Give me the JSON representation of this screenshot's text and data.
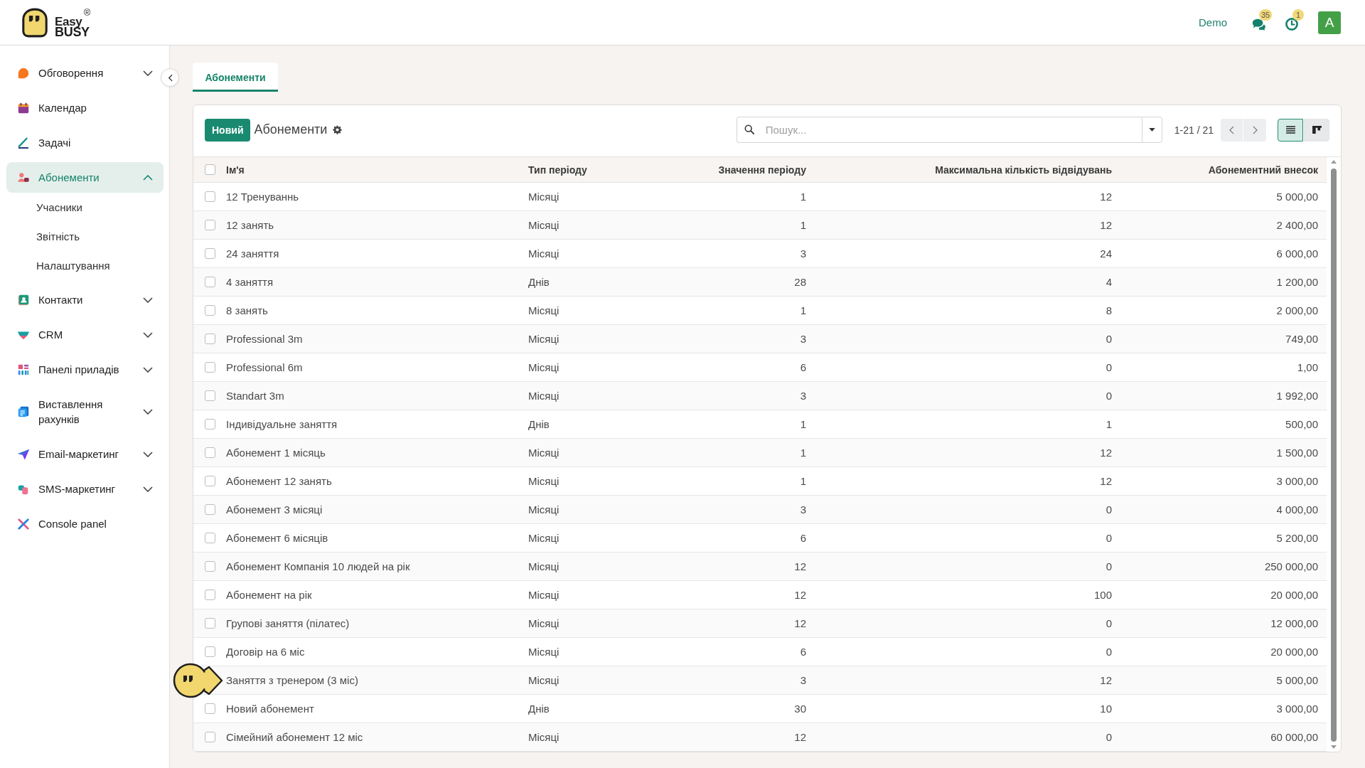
{
  "header": {
    "logo": {
      "word_top": "Easy",
      "word_bottom": "BUSY",
      "registered": "®"
    },
    "company": "Demo",
    "notifications": [
      {
        "kind": "messages",
        "count": "35"
      },
      {
        "kind": "activities",
        "count": "1"
      }
    ],
    "avatar_letter": "A"
  },
  "sidebar": {
    "items": [
      {
        "kind": "group",
        "label": "Обговорення",
        "selected": false,
        "expanded": false
      },
      {
        "kind": "link",
        "label": "Календар",
        "selected": false
      },
      {
        "kind": "link",
        "label": "Задачі",
        "selected": false
      },
      {
        "kind": "group",
        "label": "Абонементи",
        "selected": true,
        "expanded": true,
        "children": [
          {
            "label": "Учасники",
            "selected": false
          },
          {
            "label": "Звітність",
            "selected": false
          },
          {
            "label": "Налаштування",
            "selected": false
          }
        ]
      },
      {
        "kind": "group",
        "label": "Контакти",
        "selected": false,
        "expanded": false
      },
      {
        "kind": "group",
        "label": "CRM",
        "selected": false,
        "expanded": false
      },
      {
        "kind": "group",
        "label": "Панелі приладів",
        "selected": false,
        "expanded": false
      },
      {
        "kind": "group",
        "label": "Виставлення рахунків",
        "selected": false,
        "expanded": false
      },
      {
        "kind": "group",
        "label": "Email-маркетинг",
        "selected": false,
        "expanded": false
      },
      {
        "kind": "group",
        "label": "SMS-маркетинг",
        "selected": false,
        "expanded": false
      },
      {
        "kind": "link",
        "label": "Console panel",
        "selected": false
      }
    ]
  },
  "tabs": [
    {
      "label": "Абонементи",
      "selected": true
    }
  ],
  "toolbar": {
    "new_button": "Новий",
    "title": "Абонементи",
    "search": {
      "placeholder": "Пошук..."
    },
    "pager": "1-21 / 21",
    "views": [
      {
        "kind": "list",
        "selected": true
      },
      {
        "kind": "kanban",
        "selected": false
      }
    ]
  },
  "table": {
    "select_all_checked": false,
    "columns": [
      {
        "label": "Ім'я",
        "kind": "text"
      },
      {
        "label": "Тип періоду",
        "kind": "text"
      },
      {
        "label": "Значення періоду",
        "kind": "number"
      },
      {
        "label": "Максимальна кількість відвідувань",
        "kind": "number"
      },
      {
        "label": "Абонементний внесок",
        "kind": "number"
      }
    ],
    "rows": [
      {
        "checked": false,
        "cells": [
          "12 Тренуваннь",
          "Місяці",
          "1",
          "12",
          "5 000,00"
        ]
      },
      {
        "checked": false,
        "cells": [
          "12 занять",
          "Місяці",
          "1",
          "12",
          "2 400,00"
        ]
      },
      {
        "checked": false,
        "cells": [
          "24 заняття",
          "Місяці",
          "3",
          "24",
          "6 000,00"
        ]
      },
      {
        "checked": false,
        "cells": [
          "4 заняття",
          "Днів",
          "28",
          "4",
          "1 200,00"
        ]
      },
      {
        "checked": false,
        "cells": [
          "8 занять",
          "Місяці",
          "1",
          "8",
          "2 000,00"
        ]
      },
      {
        "checked": false,
        "cells": [
          "Professional 3m",
          "Місяці",
          "3",
          "0",
          "749,00"
        ]
      },
      {
        "checked": false,
        "cells": [
          "Professional 6m",
          "Місяці",
          "6",
          "0",
          "1,00"
        ]
      },
      {
        "checked": false,
        "cells": [
          "Standart 3m",
          "Місяці",
          "3",
          "0",
          "1 992,00"
        ]
      },
      {
        "checked": false,
        "cells": [
          "Індивідуальне заняття",
          "Днів",
          "1",
          "1",
          "500,00"
        ]
      },
      {
        "checked": false,
        "cells": [
          "Абонемент 1 місяць",
          "Місяці",
          "1",
          "12",
          "1 500,00"
        ]
      },
      {
        "checked": false,
        "cells": [
          "Абонемент 12 занять",
          "Місяці",
          "1",
          "12",
          "3 000,00"
        ]
      },
      {
        "checked": false,
        "cells": [
          "Абонемент 3 місяці",
          "Місяці",
          "3",
          "0",
          "4 000,00"
        ]
      },
      {
        "checked": false,
        "cells": [
          "Абонемент 6 місяців",
          "Місяці",
          "6",
          "0",
          "5 200,00"
        ]
      },
      {
        "checked": false,
        "cells": [
          "Абонемент Компанія 10 людей на рік",
          "Місяці",
          "12",
          "0",
          "250 000,00"
        ]
      },
      {
        "checked": false,
        "cells": [
          "Абонемент на рік",
          "Місяці",
          "12",
          "100",
          "20 000,00"
        ]
      },
      {
        "checked": false,
        "cells": [
          "Групові заняття (пілатес)",
          "Місяці",
          "12",
          "0",
          "12 000,00"
        ]
      },
      {
        "checked": false,
        "cells": [
          "Договір на 6 міс",
          "Місяці",
          "6",
          "0",
          "20 000,00"
        ]
      },
      {
        "cells": [
          "Заняття з тренером (3 міс)",
          "Місяці",
          "3",
          "12",
          "5 000,00"
        ]
      },
      {
        "checked": false,
        "cells": [
          "Новий абонемент",
          "Днів",
          "30",
          "10",
          "3 000,00"
        ]
      },
      {
        "checked": false,
        "cells": [
          "Сімейний абонемент 12 міс",
          "Місяці",
          "12",
          "0",
          "60 000,00"
        ]
      }
    ]
  }
}
